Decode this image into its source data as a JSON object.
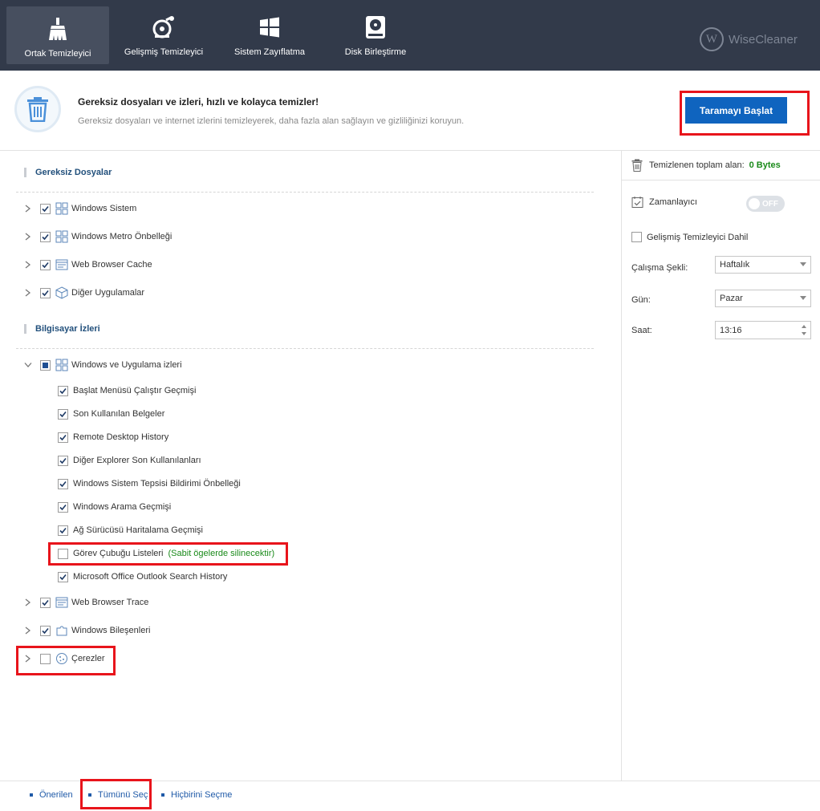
{
  "nav": {
    "tabs": [
      {
        "label": "Ortak Temizleyici",
        "icon": "broom-icon",
        "active": true
      },
      {
        "label": "Gelişmiş Temizleyici",
        "icon": "vacuum-icon",
        "active": false
      },
      {
        "label": "Sistem Zayıflatma",
        "icon": "windows-icon",
        "active": false
      },
      {
        "label": "Disk Birleştirme",
        "icon": "disk-icon",
        "active": false
      }
    ],
    "brand": "WiseCleaner",
    "brand_logo_letter": "W"
  },
  "header": {
    "title": "Gereksiz dosyaları ve izleri, hızlı ve kolayca temizler!",
    "description": "Gereksiz dosyaları ve internet izlerini temizleyerek, daha fazla alan sağlayın ve gizliliğinizi koruyun.",
    "scan_button": "Taramayı Başlat"
  },
  "junk_files": {
    "title": "Gereksiz Dosyalar",
    "items": [
      {
        "label": "Windows Sistem",
        "checked": true,
        "icon": "windows-tiles-icon"
      },
      {
        "label": "Windows Metro Önbelleği",
        "checked": true,
        "icon": "windows-tiles-icon"
      },
      {
        "label": "Web Browser Cache",
        "checked": true,
        "icon": "browser-window-icon"
      },
      {
        "label": "Diğer Uygulamalar",
        "checked": true,
        "icon": "package-icon"
      }
    ]
  },
  "traces": {
    "title": "Bilgisayar İzleri",
    "group": {
      "label": "Windows ve Uygulama izleri",
      "state": "partial",
      "expanded": true,
      "children": [
        {
          "label": "Başlat Menüsü Çalıştır Geçmişi",
          "checked": true
        },
        {
          "label": "Son Kullanılan Belgeler",
          "checked": true
        },
        {
          "label": "Remote Desktop History",
          "checked": true
        },
        {
          "label": "Diğer Explorer Son Kullanılanları",
          "checked": true
        },
        {
          "label": "Windows Sistem Tepsisi Bildirimi Önbelleği",
          "checked": true
        },
        {
          "label": "Windows Arama Geçmişi",
          "checked": true
        },
        {
          "label": "Ağ Sürücüsü Haritalama Geçmişi",
          "checked": true
        },
        {
          "label": "Görev Çubuğu Listeleri",
          "checked": false,
          "note": "(Sabit ögelerde silinecektir)"
        },
        {
          "label": "Microsoft Office Outlook Search History",
          "checked": true
        }
      ]
    },
    "items": [
      {
        "label": "Web Browser Trace",
        "checked": true,
        "icon": "browser-window-icon"
      },
      {
        "label": "Windows Bileşenleri",
        "checked": true,
        "icon": "puzzle-icon"
      },
      {
        "label": "Çerezler",
        "checked": false,
        "icon": "cookie-icon"
      }
    ]
  },
  "right": {
    "total_label": "Temizlenen toplam alan:",
    "total_value": "0 Bytes",
    "scheduler_label": "Zamanlayıcı",
    "toggle_label": "OFF",
    "advanced_label": "Gelişmiş Temizleyici Dahil",
    "advanced_checked": false,
    "mode_label": "Çalışma Şekli:",
    "mode_value": "Haftalık",
    "day_label": "Gün:",
    "day_value": "Pazar",
    "time_label": "Saat:",
    "time_value": "13:16"
  },
  "footer": {
    "recommended": "Önerilen",
    "select_all": "Tümünü Seç",
    "select_none": "Hiçbirini Seçme"
  },
  "colors": {
    "nav_bg": "#323a4a",
    "accent_blue": "#0f64bf",
    "success_green": "#1a8a1a",
    "highlight_red": "#e8141b"
  }
}
